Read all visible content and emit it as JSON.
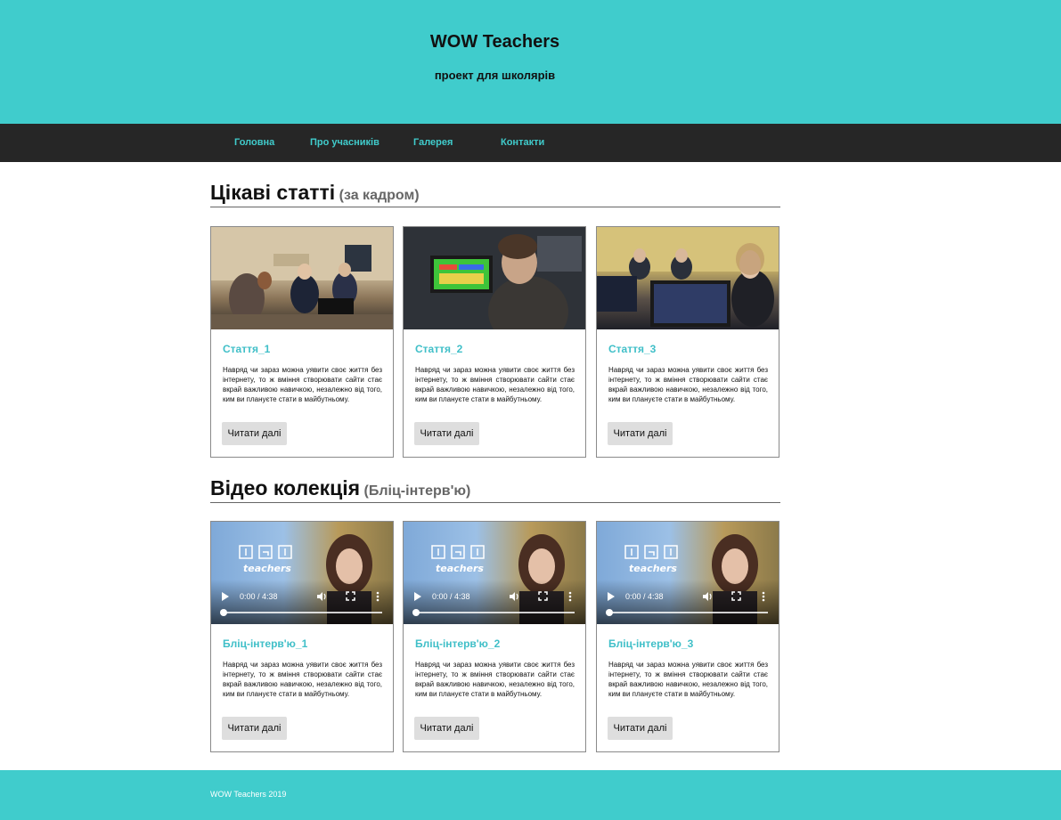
{
  "header": {
    "title": "WOW Teachers",
    "subtitle": "проект для школярів"
  },
  "nav": {
    "items": [
      {
        "label": "Головна"
      },
      {
        "label": "Про учасників"
      },
      {
        "label": "Галерея"
      },
      {
        "label": "Контакти"
      }
    ]
  },
  "articles": {
    "heading": "Цікаві статті",
    "heading_sub": "(за кадром)",
    "cards": [
      {
        "title": "Стаття_1",
        "text": "Навряд чи зараз можна уявити своє життя без інтернету, то ж вміння створювати сайти стає вкрай важливою навичкою, незалежно від того, ким ви плануєте стати в майбутньому.",
        "button": "Читати далі"
      },
      {
        "title": "Стаття_2",
        "text": "Навряд чи зараз можна уявити своє життя без інтернету, то ж вміння створювати сайти стає вкрай важливою навичкою, незалежно від того, ким ви плануєте стати в майбутньому.",
        "button": "Читати далі"
      },
      {
        "title": "Стаття_3",
        "text": "Навряд чи зараз можна уявити своє життя без інтернету, то ж вміння створювати сайти стає вкрай важливою навичкою, незалежно від того, ким ви плануєте стати в майбутньому.",
        "button": "Читати далі"
      }
    ]
  },
  "videos": {
    "heading": "Відео колекція",
    "heading_sub": "(Бліц-інтерв'ю)",
    "cards": [
      {
        "title": "Бліц-інтерв'ю_1",
        "time": "0:00 / 4:38",
        "text": "Навряд чи зараз можна уявити своє життя без інтернету, то ж вміння створювати сайти стає вкрай важливою навичкою, незалежно від того, ким ви плануєте стати в майбутньому.",
        "button": "Читати далі"
      },
      {
        "title": "Бліц-інтерв'ю_2",
        "time": "0:00 / 4:38",
        "text": "Навряд чи зараз можна уявити своє життя без інтернету, то ж вміння створювати сайти стає вкрай важливою навичкою, незалежно від того, ким ви плануєте стати в майбутньому.",
        "button": "Читати далі"
      },
      {
        "title": "Бліц-інтерв'ю_3",
        "time": "0:00 / 4:38",
        "text": "Навряд чи зараз можна уявити своє життя без інтернету, то ж вміння створювати сайти стає вкрай важливою навичкою, незалежно від того, ким ви плануєте стати в майбутньому.",
        "button": "Читати далі"
      }
    ],
    "logo_text": "teachers"
  },
  "footer": {
    "text": "WOW Teachers 2019"
  },
  "colors": {
    "accent": "#40cccc",
    "nav_bg": "#262626",
    "link": "#40bfc8",
    "button_bg": "#dedede"
  }
}
